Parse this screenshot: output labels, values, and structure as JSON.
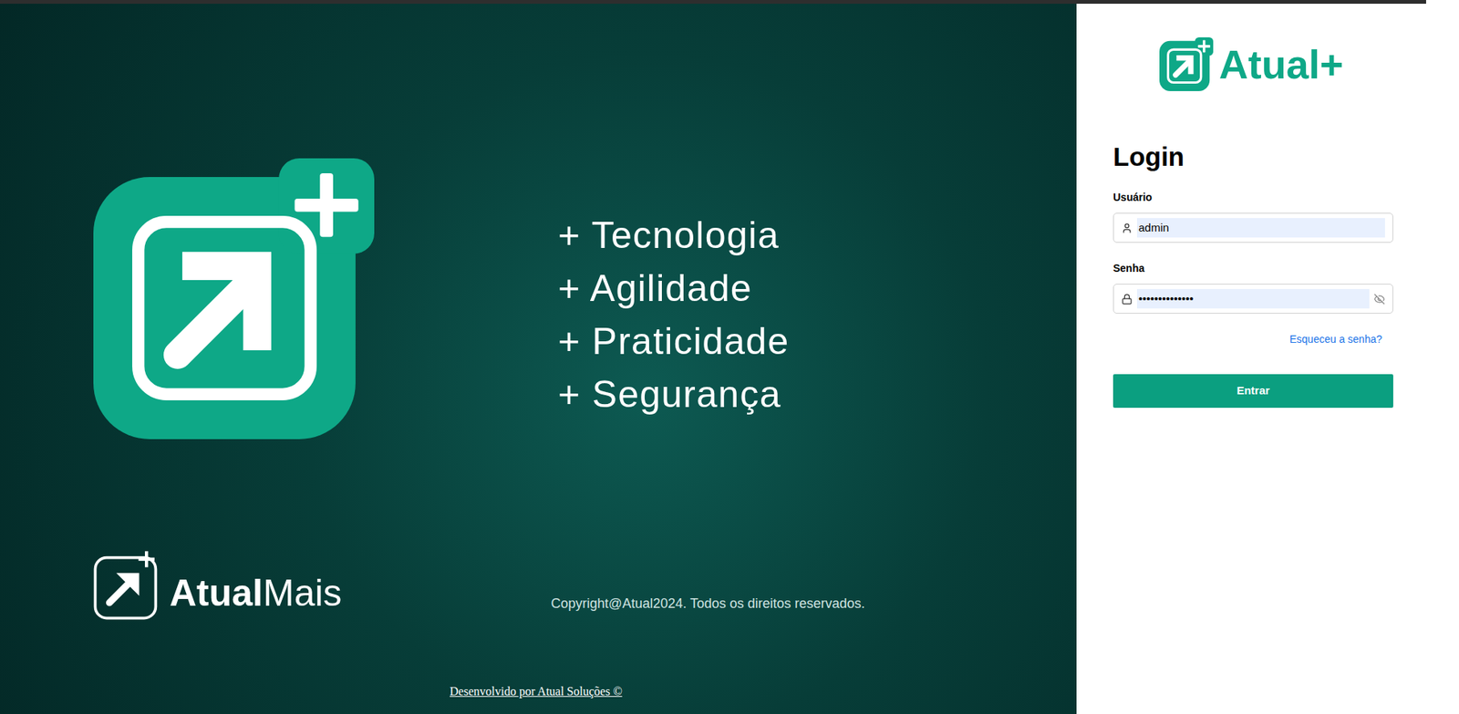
{
  "banner": {
    "taglines": [
      "+ Tecnologia",
      "+ Agilidade",
      "+ Praticidade",
      "+ Segurança"
    ],
    "bottom_logo": {
      "bold": "Atual",
      "light": "Mais"
    },
    "copyright": "Copyright@Atual2024. Todos os direitos reservados.",
    "developer_link": "Desenvolvido por Atual Soluções ©"
  },
  "header_logo": {
    "name": "Atual",
    "suffix": "+"
  },
  "login": {
    "title": "Login",
    "fields": [
      {
        "label": "Usuário",
        "value": "admin",
        "kind": "text"
      },
      {
        "label": "Senha",
        "value": "••••••••••••••",
        "kind": "password"
      }
    ],
    "forgot_link": "Esqueceu a senha?",
    "button": "Entrar"
  }
}
